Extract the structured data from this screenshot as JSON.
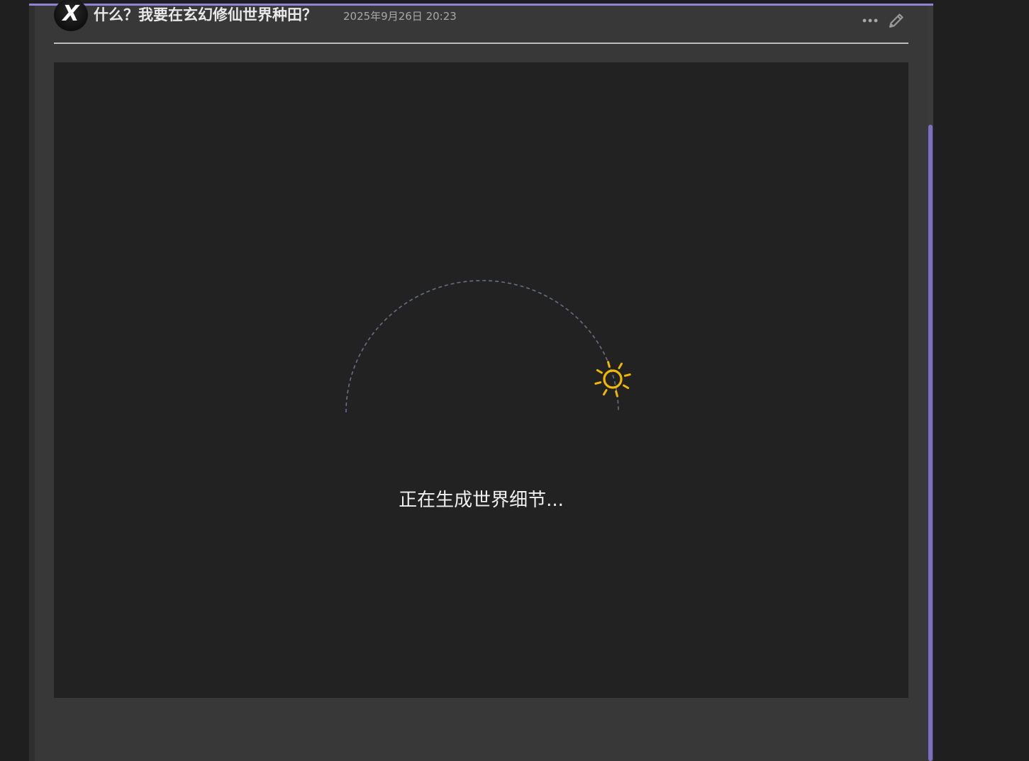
{
  "message": {
    "avatar_letter": "X",
    "title": "什么？我要在玄幻修仙世界种田？",
    "timestamp": "2025年9月26日 20:23",
    "actions": {
      "more_icon": "more-horizontal-icon",
      "edit_icon": "pencil-icon"
    }
  },
  "loading": {
    "text": "正在生成世界细节...",
    "icon": "sun-icon"
  },
  "colors": {
    "accent": "#8f83d6",
    "scroll_thumb": "#7b70c4",
    "sun": "#f2b800",
    "arc": "#6b7080"
  }
}
